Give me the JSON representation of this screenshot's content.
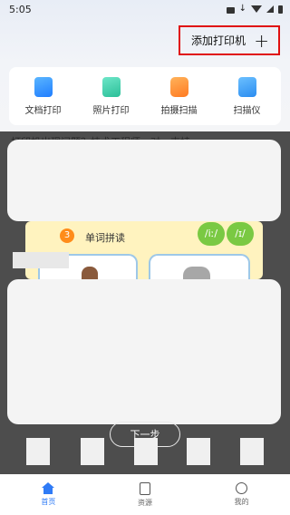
{
  "status_bar": {
    "time": "5:05"
  },
  "header": {
    "add_printer_label": "添加打印机",
    "add_icon": "plus-icon"
  },
  "functions": [
    {
      "label": "文档打印",
      "icon": "document-print-icon"
    },
    {
      "label": "照片打印",
      "icon": "photo-print-icon"
    },
    {
      "label": "拍摄扫描",
      "icon": "camera-scan-icon"
    },
    {
      "label": "扫描仪",
      "icon": "scanner-icon"
    }
  ],
  "background_text": "打印机出现问题？技术工程师一对一支持",
  "tutorial": {
    "lesson_number": "3",
    "lesson_title": "单词拼读",
    "phonetic_1": "/iː/",
    "phonetic_2": "/ɪ/",
    "next_button": "下一步"
  },
  "bottom_nav": [
    {
      "label": "首页",
      "icon": "home-icon",
      "active": true
    },
    {
      "label": "资源",
      "icon": "document-icon",
      "active": false
    },
    {
      "label": "我的",
      "icon": "user-icon",
      "active": false
    }
  ],
  "colors": {
    "accent": "#2f7bf6",
    "highlight_border": "#e01010",
    "overlay": "#4d4d4d"
  }
}
